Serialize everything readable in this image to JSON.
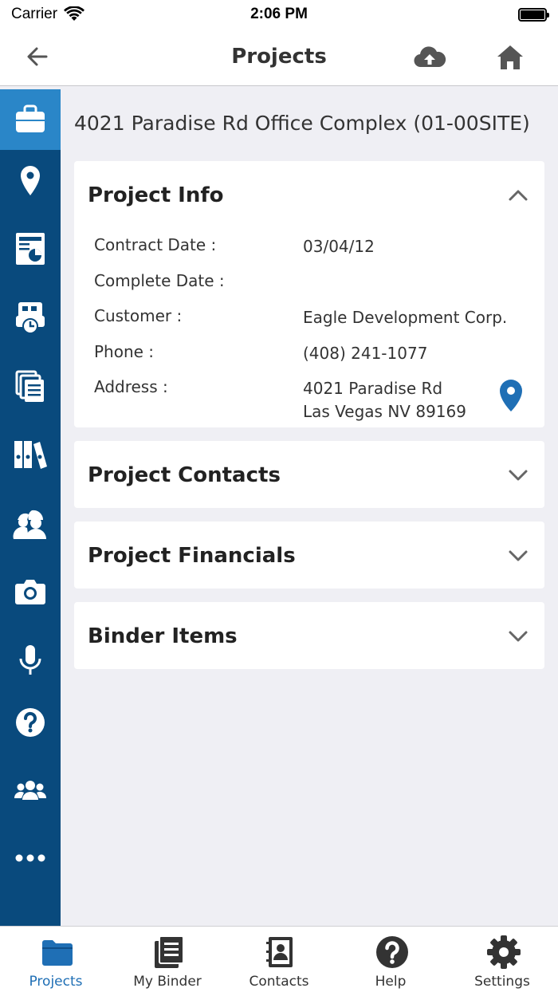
{
  "status_bar": {
    "carrier": "Carrier",
    "time": "2:06 PM"
  },
  "nav": {
    "title": "Projects"
  },
  "sidebar": {
    "items": [
      {
        "icon": "briefcase-icon",
        "active": true
      },
      {
        "icon": "location-pin-icon"
      },
      {
        "icon": "report-chart-icon"
      },
      {
        "icon": "timesheet-clock-icon"
      },
      {
        "icon": "documents-icon"
      },
      {
        "icon": "binders-icon"
      },
      {
        "icon": "workers-icon"
      },
      {
        "icon": "camera-icon"
      },
      {
        "icon": "microphone-icon"
      },
      {
        "icon": "help-icon"
      },
      {
        "icon": "group-icon"
      },
      {
        "icon": "more-icon"
      }
    ]
  },
  "project": {
    "title": "4021 Paradise Rd Office Complex  (01-00SITE)"
  },
  "project_info": {
    "heading": "Project Info",
    "contract_date_label": "Contract Date :",
    "contract_date_value": "03/04/12",
    "complete_date_label": "Complete Date :",
    "complete_date_value": "",
    "customer_label": "Customer :",
    "customer_value": "Eagle Development Corp.",
    "phone_label": "Phone :",
    "phone_value": "(408) 241-1077",
    "address_label": "Address :",
    "address_line1": "4021 Paradise Rd",
    "address_line2": "Las Vegas NV 89169"
  },
  "sections": {
    "contacts": "Project Contacts",
    "financials": "Project Financials",
    "binder": "Binder Items"
  },
  "tabs": [
    {
      "label": "Projects",
      "icon": "folder-icon",
      "active": true
    },
    {
      "label": "My Binder",
      "icon": "binder-book-icon"
    },
    {
      "label": "Contacts",
      "icon": "contacts-book-icon"
    },
    {
      "label": "Help",
      "icon": "help-circle-icon"
    },
    {
      "label": "Settings",
      "icon": "gear-icon"
    }
  ],
  "colors": {
    "sidebar": "#094a7d",
    "sidebar_active": "#2a86c8",
    "accent": "#1f6fb5",
    "background": "#efeff4"
  }
}
